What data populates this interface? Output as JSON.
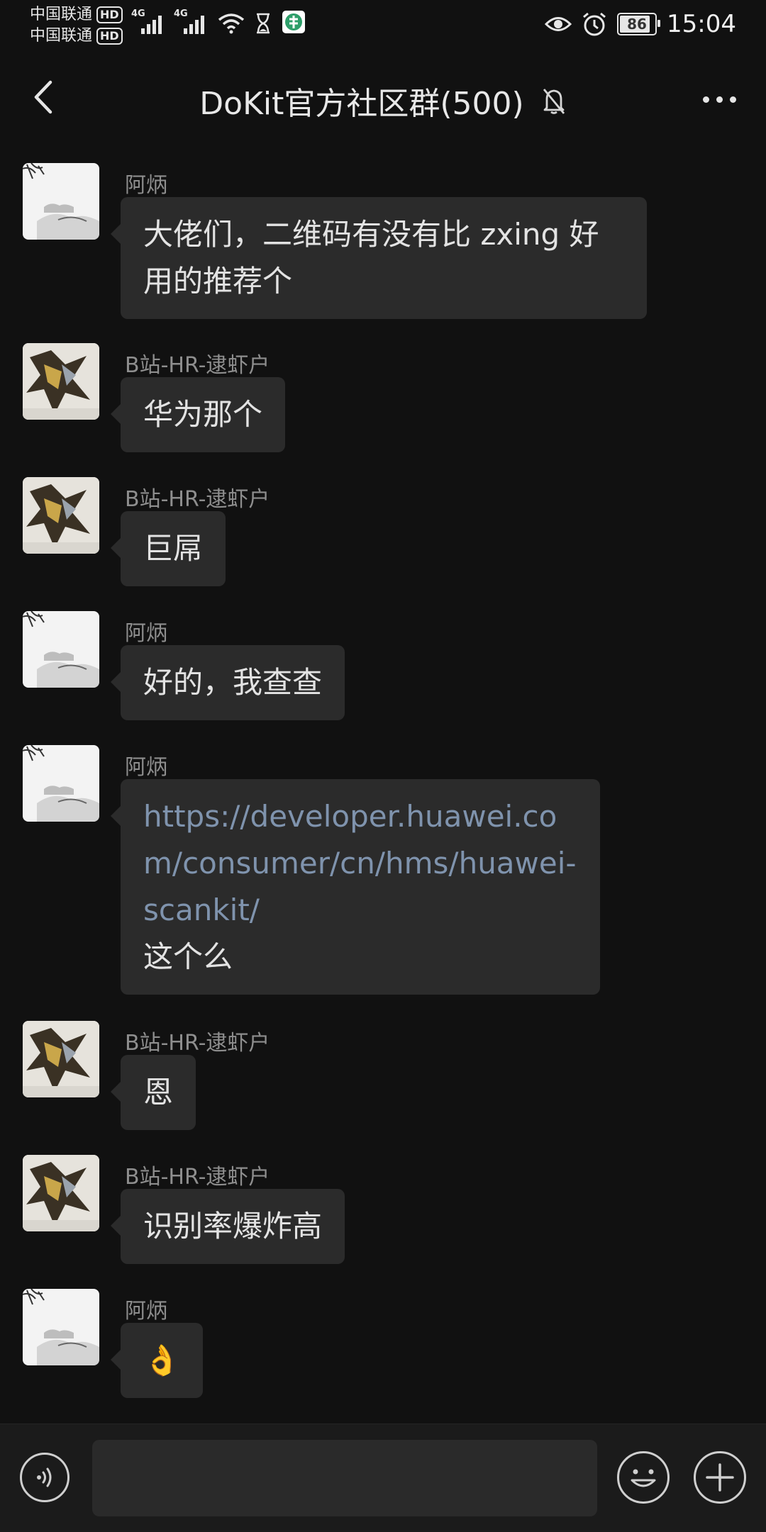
{
  "status_bar": {
    "carrier1": "中国联通",
    "carrier2": "中国联通",
    "hd": "HD",
    "network1": "4G",
    "network2": "4G",
    "battery": "86",
    "time": "15:04"
  },
  "header": {
    "title": "DoKit官方社区群(500)"
  },
  "messages": [
    {
      "sender": "阿炳",
      "text": "大佬们，二维码有没有比 zxing 好用的推荐个"
    },
    {
      "sender": "B站-HR-逮虾户",
      "text": "华为那个"
    },
    {
      "sender": "B站-HR-逮虾户",
      "text": "巨屌"
    },
    {
      "sender": "阿炳",
      "text": "好的，我查查"
    },
    {
      "sender": "阿炳",
      "link": "https://developer.huawei.com/consumer/cn/hms/huawei-scankit/",
      "text": "这个么"
    },
    {
      "sender": "B站-HR-逮虾户",
      "text": "恩"
    },
    {
      "sender": "B站-HR-逮虾户",
      "text": "识别率爆炸高"
    },
    {
      "sender": "阿炳",
      "text": "👌"
    }
  ],
  "input": {
    "value": ""
  },
  "colors": {
    "background": "#111111",
    "bubble": "#2b2b2b",
    "link": "#7f93ad"
  }
}
